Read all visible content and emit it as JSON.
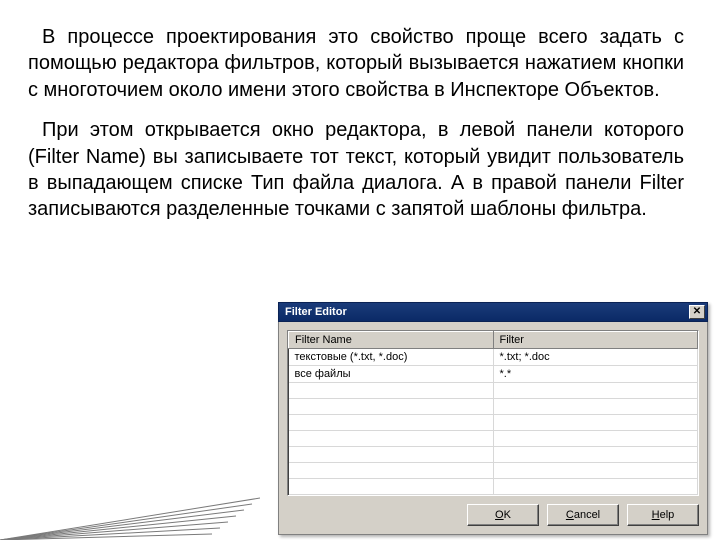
{
  "paragraphs": {
    "p1": "В процессе проектирования это свойство проще всего задать с помощью редактора фильтров, который вызывается нажатием кнопки с многоточием около имени этого свойства в Инспекторе Объектов.",
    "p2": "При этом открывается окно редактора, в левой панели которого (Filter Name) вы записываете тот текст, который увидит пользователь в выпадающем списке Тип файла диалога. А в правой панели Filter записываются разделенные точками с запятой шаблоны фильтра."
  },
  "dialog": {
    "title": "Filter Editor",
    "columns": {
      "name": "Filter Name",
      "filter": "Filter"
    },
    "rows": [
      {
        "name": "текстовые (*.txt, *.doc)",
        "filter": "*.txt; *.doc"
      },
      {
        "name": "все файлы",
        "filter": "*.*"
      }
    ],
    "buttons": {
      "ok_pre": "",
      "ok_ul": "O",
      "ok_post": "K",
      "cancel_pre": "",
      "cancel_ul": "C",
      "cancel_post": "ancel",
      "help_pre": "",
      "help_ul": "H",
      "help_post": "elp"
    },
    "close_glyph": "✕"
  }
}
